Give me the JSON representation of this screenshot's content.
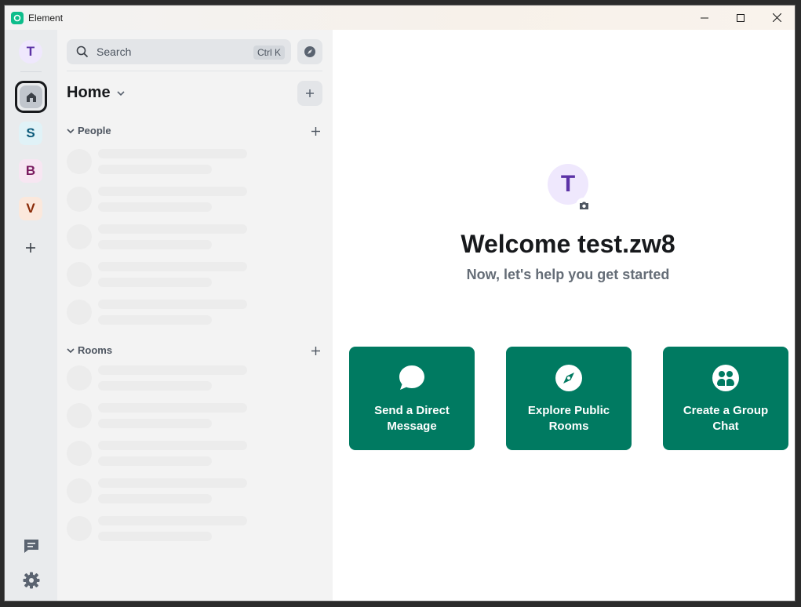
{
  "app": {
    "title": "Element",
    "accent": "#0dbd8b"
  },
  "spaces": {
    "user_initial": "T",
    "items": [
      {
        "name": "home",
        "icon": "home-icon"
      },
      {
        "initial": "S",
        "bg": "#e0f2f7",
        "fg": "#0b5a7a"
      },
      {
        "initial": "B",
        "bg": "#f7e6f2",
        "fg": "#7a1b5f"
      },
      {
        "initial": "V",
        "bg": "#fbe8dc",
        "fg": "#8a2b08"
      }
    ],
    "bottom_icons": [
      "threads-icon",
      "settings-icon"
    ]
  },
  "room_list": {
    "search_placeholder": "Search",
    "search_shortcut": "Ctrl K",
    "home_title": "Home",
    "sections": [
      {
        "label": "People"
      },
      {
        "label": "Rooms"
      }
    ]
  },
  "main": {
    "avatar_initial": "T",
    "welcome": "Welcome test.zw8",
    "subtitle": "Now, let's help you get started",
    "cards": [
      {
        "label": "Send a Direct Message",
        "icon": "chat-bubble-icon"
      },
      {
        "label": "Explore Public Rooms",
        "icon": "compass-icon"
      },
      {
        "label": "Create a Group Chat",
        "icon": "group-icon"
      }
    ],
    "card_color": "#007a61"
  }
}
